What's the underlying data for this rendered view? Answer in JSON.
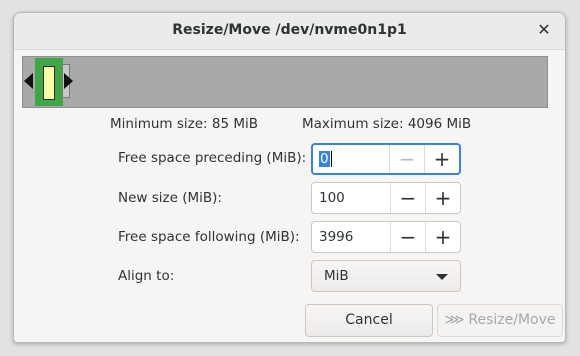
{
  "window": {
    "title": "Resize/Move /dev/nvme0n1p1",
    "close_glyph": "✕"
  },
  "size_info": {
    "minimum": "Minimum size: 85 MiB",
    "maximum": "Maximum size: 4096 MiB"
  },
  "fields": {
    "free_preceding": {
      "label": "Free space preceding (MiB):",
      "value": "0"
    },
    "new_size": {
      "label": "New size (MiB):",
      "value": "100"
    },
    "free_following": {
      "label": "Free space following (MiB):",
      "value": "3996"
    },
    "align": {
      "label": "Align to:",
      "value": "MiB"
    }
  },
  "spin_glyphs": {
    "minus": "−",
    "plus": "+"
  },
  "buttons": {
    "cancel": "Cancel",
    "resize_move": "Resize/Move",
    "resize_move_icon": "⋙"
  },
  "colors": {
    "partition_fill": "#3fa646",
    "partition_used": "#fafaaa",
    "unallocated": "#a9a9a9",
    "focus_accent": "#3584e4"
  }
}
